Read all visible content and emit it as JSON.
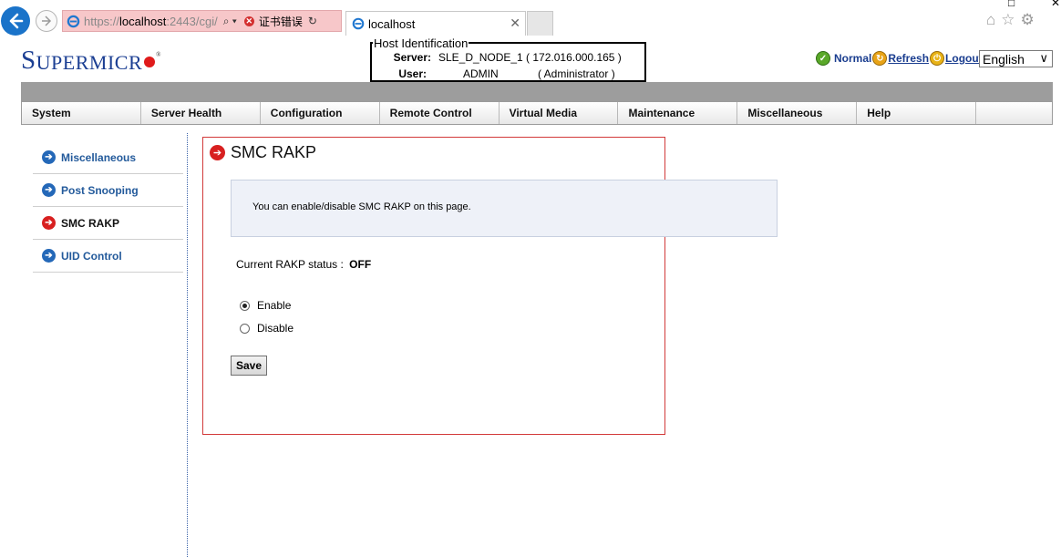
{
  "browser": {
    "url_proto": "https://",
    "url_host": "localhost",
    "url_rest": ":2443/cgi/",
    "cert_error": "证书错误",
    "tab_title": "localhost"
  },
  "brand": {
    "logo_s": "S",
    "logo_rest": "UPERMICR"
  },
  "host": {
    "legend": "Host Identification",
    "server_label": "Server:",
    "server_value": "SLE_D_NODE_1  ( 172.016.000.165 )",
    "user_label": "User:",
    "user_value": "ADMIN",
    "user_role": "( Administrator )"
  },
  "status": {
    "normal": "Normal",
    "refresh": "Refresh",
    "logout": "Logout"
  },
  "language": {
    "selected": "English"
  },
  "nav": [
    {
      "label": "System"
    },
    {
      "label": "Server Health"
    },
    {
      "label": "Configuration"
    },
    {
      "label": "Remote Control"
    },
    {
      "label": "Virtual Media"
    },
    {
      "label": "Maintenance"
    },
    {
      "label": "Miscellaneous"
    },
    {
      "label": "Help"
    }
  ],
  "sidebar": {
    "items": [
      {
        "label": "Miscellaneous"
      },
      {
        "label": "Post Snooping"
      },
      {
        "label": "SMC RAKP"
      },
      {
        "label": "UID Control"
      }
    ],
    "active_index": 2
  },
  "main": {
    "title": "SMC RAKP",
    "info": "You can enable/disable SMC RAKP on this page.",
    "status_label": "Current RAKP status :",
    "status_value": "OFF",
    "option_enable": "Enable",
    "option_disable": "Disable",
    "selected_option": "Enable",
    "save_label": "Save"
  },
  "colors": {
    "brand_blue": "#1c3f93",
    "accent_red": "#d82020",
    "panel_border": "#d23a3a",
    "link_blue": "#235a9b"
  }
}
